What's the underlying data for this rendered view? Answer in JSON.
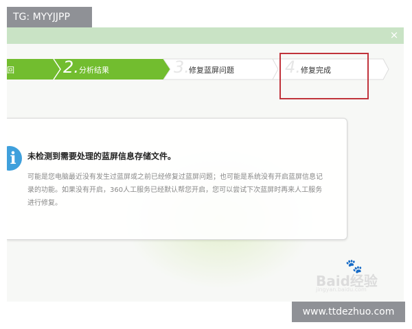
{
  "watermark_top": "TG: MYYJJPP",
  "watermark_bottom": "www.ttdezhuo.com",
  "window": {
    "close_glyph": "×"
  },
  "steps": [
    {
      "number": "",
      "label": "回",
      "state": "done"
    },
    {
      "number": "2.",
      "label": "分析结果",
      "state": "done"
    },
    {
      "number": "3.",
      "label": "修复蓝屏问题",
      "state": "pending"
    },
    {
      "number": "4.",
      "label": "修复完成",
      "state": "pending"
    }
  ],
  "message": {
    "icon": "info-icon",
    "icon_glyph": "i",
    "title": "未检测到需要处理的蓝屏信息存储文件。",
    "body": "可能是您电脑最近没有发生过蓝屏或之前已经修复过蓝屏问题；也可能是系统没有开启蓝屏信息记录的功能。如果没有开启，360人工服务已经默认帮您开启，您可以尝试下次蓝屏时再来人工服务进行修复。"
  },
  "baidu_watermark": {
    "text": "Baid经验",
    "sub": "jingyan.baidu.com"
  },
  "colors": {
    "step_done": "#72bd2f",
    "step_pending": "#ffffff",
    "highlight": "#c0323a",
    "info": "#3fa0dc",
    "titlebar": "#c9e3c5"
  }
}
